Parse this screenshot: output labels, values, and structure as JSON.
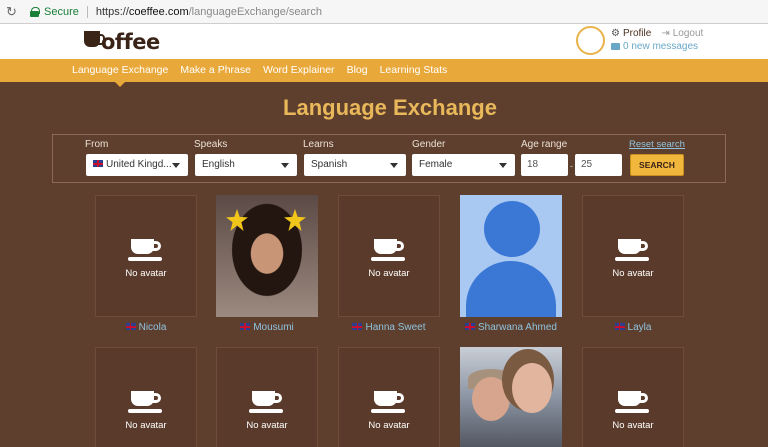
{
  "browser": {
    "secure_label": "Secure",
    "url_prefix": "https://",
    "url_host": "coeffee.com",
    "url_path": "/languageExchange/search"
  },
  "header": {
    "logo_text": "offee",
    "profile_label": "Profile",
    "logout_label": "Logout",
    "messages_label": "0 new messages"
  },
  "nav": {
    "items": [
      {
        "label": "Language Exchange"
      },
      {
        "label": "Make a Phrase"
      },
      {
        "label": "Word Explainer"
      },
      {
        "label": "Blog"
      },
      {
        "label": "Learning Stats"
      }
    ]
  },
  "page": {
    "title": "Language Exchange"
  },
  "search": {
    "from_label": "From",
    "from_value": "United Kingd...",
    "speaks_label": "Speaks",
    "speaks_value": "English",
    "learns_label": "Learns",
    "learns_value": "Spanish",
    "gender_label": "Gender",
    "gender_value": "Female",
    "age_label": "Age range",
    "age_min": "18",
    "age_max": "25",
    "reset_label": "Reset search",
    "search_label": "SEARCH"
  },
  "results": {
    "no_avatar_label": "No avatar",
    "row1": [
      {
        "name": "Nicola"
      },
      {
        "name": "Mousumi"
      },
      {
        "name": "Hanna Sweet"
      },
      {
        "name": "Sharwana Ahmed"
      },
      {
        "name": "Layla"
      }
    ]
  },
  "colors": {
    "background": "#5e3f2d",
    "accent": "#e9a93a",
    "title": "#e9b85a",
    "link": "#8fc3e0"
  }
}
